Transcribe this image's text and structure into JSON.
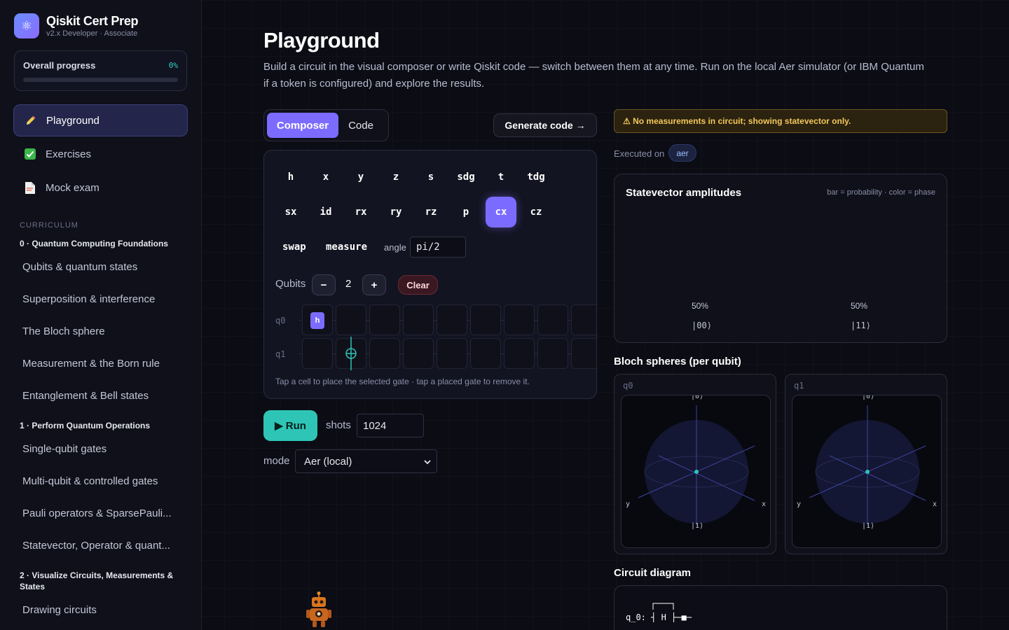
{
  "brand": {
    "title": "Qiskit Cert Prep",
    "subtitle": "v2.x Developer · Associate",
    "logo_icon": "atom-icon"
  },
  "progress": {
    "label": "Overall progress",
    "value": "0%",
    "fraction": 0
  },
  "nav": [
    {
      "label": "Playground",
      "icon": "pencil-icon",
      "active": true
    },
    {
      "label": "Exercises",
      "icon": "checkbox-icon",
      "active": false
    },
    {
      "label": "Mock exam",
      "icon": "document-icon",
      "active": false
    }
  ],
  "curriculum": {
    "heading": "CURRICULUM",
    "sections": [
      {
        "title": "0 · Quantum Computing Foundations",
        "lessons": [
          "Qubits & quantum states",
          "Superposition & interference",
          "The Bloch sphere",
          "Measurement & the Born rule",
          "Entanglement & Bell states"
        ]
      },
      {
        "title": "1 · Perform Quantum Operations",
        "lessons": [
          "Single-qubit gates",
          "Multi-qubit & controlled gates",
          "Pauli operators & SparsePauli...",
          "Statevector, Operator & quant..."
        ]
      },
      {
        "title": "2 · Visualize Circuits, Measurements & States",
        "lessons": [
          "Drawing circuits"
        ]
      }
    ]
  },
  "main": {
    "title": "Playground",
    "description": "Build a circuit in the visual composer or write Qiskit code — switch between them at any time. Run on the local Aer simulator (or IBM Quantum if a token is configured) and explore the results.",
    "tabs": [
      "Composer",
      "Code"
    ],
    "generate_label": "Generate code →"
  },
  "composer": {
    "gate_rows": [
      [
        "h",
        "x",
        "y",
        "z",
        "s",
        "sdg",
        "t",
        "tdg"
      ],
      [
        "sx",
        "id",
        "rx",
        "ry",
        "rz",
        "p",
        "cx",
        "cz"
      ],
      [
        "swap",
        "measure"
      ]
    ],
    "selected_gate": "cx",
    "angle_label": "angle",
    "angle_value": "pi/2",
    "qubits_label": "Qubits",
    "qubit_count": "2",
    "minus": "−",
    "plus": "+",
    "clear_label": "Clear",
    "wires": [
      "q0",
      "q1"
    ],
    "placed_gate": "h",
    "hint": "Tap a cell to place the selected gate · tap a placed gate to remove it."
  },
  "run": {
    "run_label": "▶ Run",
    "shots_label": "shots",
    "shots_value": "1024",
    "mode_label": "mode",
    "mode_value": "Aer (local)"
  },
  "results": {
    "warning": "⚠ No measurements in circuit; showing statevector only.",
    "executed_label": "Executed on",
    "backend": "aer",
    "statevector_title": "Statevector amplitudes",
    "statevector_note": "bar = probability · color = phase",
    "amplitudes": [
      {
        "state": "|00⟩",
        "pct": "50%"
      },
      {
        "state": "|11⟩",
        "pct": "50%"
      }
    ],
    "bloch_title": "Bloch spheres (per qubit)",
    "bloch": [
      {
        "qubit": "q0",
        "top": "|0⟩",
        "bottom": "|1⟩",
        "x": "x",
        "y": "y"
      },
      {
        "qubit": "q1",
        "top": "|0⟩",
        "bottom": "|1⟩",
        "x": "x",
        "y": "y"
      }
    ],
    "diagram_title": "Circuit diagram",
    "diagram_line": "q_0: ┤ H ├─■─"
  },
  "colors": {
    "accent": "#7b6cff",
    "teal": "#2ec5b6",
    "warning": "#f4c75a",
    "bg": "#0b0c14"
  }
}
